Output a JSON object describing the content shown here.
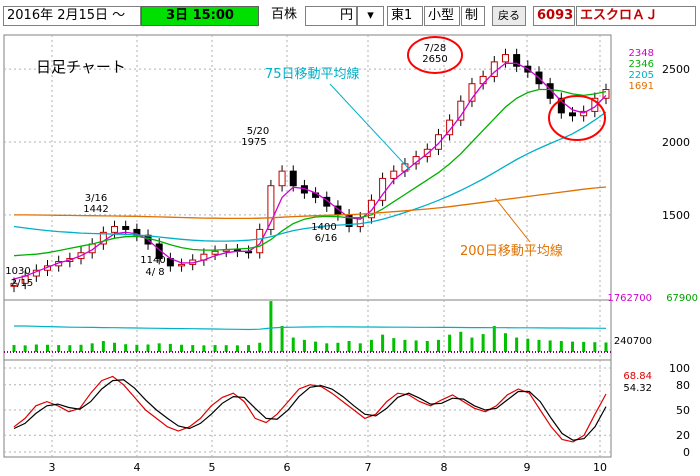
{
  "toolbar": {
    "date_range": "2016年  2月15日 ～",
    "period_time": "3日  15:00",
    "unit_label": "百株",
    "price_unit": "円",
    "select_arrow": "▾",
    "market": "東1",
    "size_class": "小型",
    "margin_kbn": "制",
    "back_button": "戻る",
    "stock_code": "6093",
    "stock_name": "エスクロＡＪ"
  },
  "colors": {
    "ma_short": "#d000d0",
    "ma_mid": "#00b000",
    "ma_75": "#00b0c8",
    "ma_200": "#e07000",
    "candle": "#c00000",
    "volume": "#00c000",
    "stoch_k": "#e00000",
    "stoch_d": "#000000",
    "highlight": "#ff0000"
  },
  "chart_data": [
    {
      "type": "candlestick",
      "title": "日足チャート",
      "x_tick_labels": [
        "3",
        "4",
        "5",
        "6",
        "7",
        "8",
        "9",
        "10"
      ],
      "y_tick_labels": [
        "2500",
        "2000",
        "1500"
      ],
      "ylim": [
        950,
        2700
      ],
      "legend_values": [
        {
          "value": "2348",
          "color": "#d000d0"
        },
        {
          "value": "2346",
          "color": "#00b000"
        },
        {
          "value": "2205",
          "color": "#00b0c8"
        },
        {
          "value": "1691",
          "color": "#e07000"
        }
      ],
      "annotations": {
        "ma75": "75日移動平均線",
        "ma200": "200日移動平均線",
        "low_feb": {
          "price": "1030",
          "date": "2/15"
        },
        "high_mar": {
          "date": "3/16",
          "price": "1442"
        },
        "low_apr": {
          "price": "1140",
          "date": "4/ 8"
        },
        "high_may": {
          "date": "5/20",
          "price": "1975"
        },
        "low_jun": {
          "price": "1400",
          "date": "6/16"
        },
        "high_jul": {
          "date": "7/28",
          "price": "2650"
        }
      },
      "series": [
        {
          "name": "close",
          "values": [
            1030,
            1080,
            1120,
            1150,
            1180,
            1200,
            1240,
            1300,
            1380,
            1420,
            1400,
            1360,
            1300,
            1200,
            1150,
            1160,
            1190,
            1230,
            1250,
            1260,
            1250,
            1240,
            1400,
            1700,
            1800,
            1700,
            1650,
            1620,
            1560,
            1500,
            1420,
            1480,
            1600,
            1750,
            1800,
            1850,
            1900,
            1950,
            2050,
            2150,
            2280,
            2400,
            2450,
            2550,
            2600,
            2520,
            2480,
            2400,
            2300,
            2200,
            2180,
            2210,
            2300,
            2360
          ]
        },
        {
          "name": "ma_short",
          "values": [
            1060,
            1080,
            1110,
            1140,
            1170,
            1190,
            1220,
            1260,
            1320,
            1370,
            1380,
            1370,
            1330,
            1260,
            1200,
            1170,
            1170,
            1190,
            1220,
            1240,
            1250,
            1250,
            1300,
            1450,
            1620,
            1690,
            1680,
            1650,
            1600,
            1540,
            1480,
            1470,
            1530,
            1640,
            1740,
            1800,
            1860,
            1920,
            1990,
            2080,
            2180,
            2300,
            2400,
            2480,
            2540,
            2540,
            2500,
            2440,
            2360,
            2280,
            2220,
            2200,
            2240,
            2320
          ]
        },
        {
          "name": "ma_mid",
          "values": [
            1220,
            1225,
            1230,
            1240,
            1255,
            1270,
            1285,
            1300,
            1320,
            1340,
            1350,
            1352,
            1340,
            1320,
            1295,
            1275,
            1262,
            1258,
            1258,
            1262,
            1266,
            1270,
            1285,
            1330,
            1390,
            1440,
            1470,
            1485,
            1490,
            1488,
            1480,
            1482,
            1500,
            1540,
            1590,
            1640,
            1690,
            1740,
            1790,
            1850,
            1920,
            2000,
            2080,
            2160,
            2240,
            2300,
            2340,
            2360,
            2360,
            2350,
            2330,
            2320,
            2330,
            2346
          ]
        },
        {
          "name": "ma_75",
          "values": [
            1420,
            1410,
            1400,
            1392,
            1385,
            1380,
            1375,
            1372,
            1370,
            1368,
            1366,
            1362,
            1356,
            1348,
            1340,
            1332,
            1326,
            1322,
            1320,
            1320,
            1322,
            1326,
            1334,
            1350,
            1372,
            1392,
            1406,
            1416,
            1424,
            1430,
            1434,
            1440,
            1452,
            1470,
            1492,
            1516,
            1542,
            1570,
            1600,
            1632,
            1668,
            1706,
            1746,
            1790,
            1836,
            1880,
            1920,
            1956,
            1990,
            2022,
            2056,
            2100,
            2150,
            2205
          ]
        },
        {
          "name": "ma_200",
          "values": [
            1500,
            1500,
            1499,
            1498,
            1497,
            1496,
            1495,
            1494,
            1493,
            1492,
            1491,
            1490,
            1488,
            1486,
            1484,
            1482,
            1480,
            1478,
            1477,
            1476,
            1476,
            1476,
            1477,
            1480,
            1484,
            1488,
            1491,
            1494,
            1497,
            1500,
            1502,
            1505,
            1510,
            1516,
            1522,
            1528,
            1534,
            1540,
            1548,
            1556,
            1566,
            1576,
            1586,
            1596,
            1606,
            1616,
            1626,
            1636,
            1646,
            1656,
            1666,
            1676,
            1684,
            1691
          ]
        }
      ]
    },
    {
      "type": "bar",
      "title": "",
      "y_tick_labels": [
        "1762700",
        "240700"
      ],
      "right_value": "67900",
      "ylim": [
        0,
        1800000
      ],
      "values": [
        240700,
        230000,
        260000,
        250000,
        240000,
        235000,
        250000,
        300000,
        380000,
        320000,
        270000,
        250000,
        260000,
        300000,
        280000,
        250000,
        240000,
        230000,
        240000,
        235000,
        230000,
        240000,
        320000,
        1762700,
        900000,
        500000,
        420000,
        360000,
        300000,
        320000,
        380000,
        300000,
        420000,
        600000,
        480000,
        420000,
        400000,
        380000,
        420000,
        600000,
        700000,
        500000,
        620000,
        900000,
        650000,
        500000,
        460000,
        420000,
        400000,
        380000,
        360000,
        350000,
        340000,
        330000
      ],
      "ma_values": [
        900000,
        900000,
        890000,
        880000,
        870000,
        860000,
        855000,
        850000,
        845000,
        840000,
        835000,
        830000,
        825000,
        820000,
        815000,
        810000,
        805000,
        800000,
        795000,
        790000,
        785000,
        780000,
        790000,
        830000,
        850000,
        860000,
        865000,
        870000,
        872000,
        870000,
        868000,
        866000,
        864000,
        862000,
        860000,
        858000,
        856000,
        854000,
        852000,
        850000,
        848000,
        846000,
        844000,
        842000,
        840000,
        838000,
        836000,
        834000,
        832000,
        830000,
        828000,
        826000,
        824000,
        822000
      ]
    },
    {
      "type": "line",
      "title": "",
      "y_tick_labels": [
        "100",
        "80",
        "50",
        "20",
        "0"
      ],
      "ylim": [
        0,
        100
      ],
      "legend_values": [
        {
          "value": "68.84",
          "color": "#e00000"
        },
        {
          "value": "54.32",
          "color": "#000000"
        }
      ],
      "series": [
        {
          "name": "%K",
          "values": [
            30,
            40,
            55,
            60,
            55,
            48,
            52,
            70,
            85,
            90,
            80,
            65,
            50,
            40,
            30,
            25,
            30,
            40,
            55,
            65,
            70,
            60,
            40,
            35,
            45,
            60,
            75,
            80,
            78,
            70,
            60,
            50,
            40,
            45,
            60,
            70,
            68,
            60,
            55,
            62,
            68,
            60,
            52,
            48,
            55,
            68,
            75,
            70,
            50,
            30,
            15,
            12,
            20,
            45,
            69
          ]
        },
        {
          "name": "%D",
          "values": [
            28,
            34,
            46,
            55,
            57,
            53,
            51,
            60,
            75,
            85,
            86,
            76,
            62,
            50,
            40,
            31,
            28,
            34,
            45,
            58,
            66,
            65,
            52,
            40,
            39,
            50,
            66,
            77,
            79,
            75,
            66,
            55,
            45,
            43,
            52,
            65,
            70,
            64,
            57,
            58,
            64,
            63,
            55,
            50,
            52,
            62,
            72,
            72,
            60,
            40,
            22,
            14,
            16,
            30,
            54
          ]
        }
      ]
    }
  ]
}
